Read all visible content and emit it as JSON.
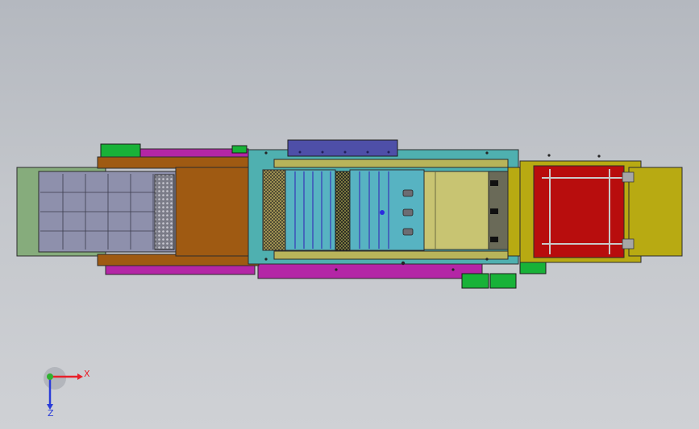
{
  "viewport": {
    "background_top": "#b4b8bf",
    "background_bottom": "#cfd1d5"
  },
  "triad": {
    "x_label": "X",
    "z_label": "Z",
    "x_color": "#e8202a",
    "z_color": "#2a3cd8",
    "y_color": "#2fb12f"
  },
  "parts": {
    "left_extension_color": "#86ac7c",
    "grid_panel_color": "#8e90ac",
    "brown_chamber_color": "#9f5a12",
    "magenta_rail_color": "#b426a6",
    "teal_frame_color": "#4fb0b0",
    "blue_housing_color": "#4e4fa8",
    "olive_section_color": "#b8b45a",
    "red_chamber_color": "#b80d0d",
    "right_housing_color": "#b8aa12",
    "green_block_color": "#18b238"
  }
}
